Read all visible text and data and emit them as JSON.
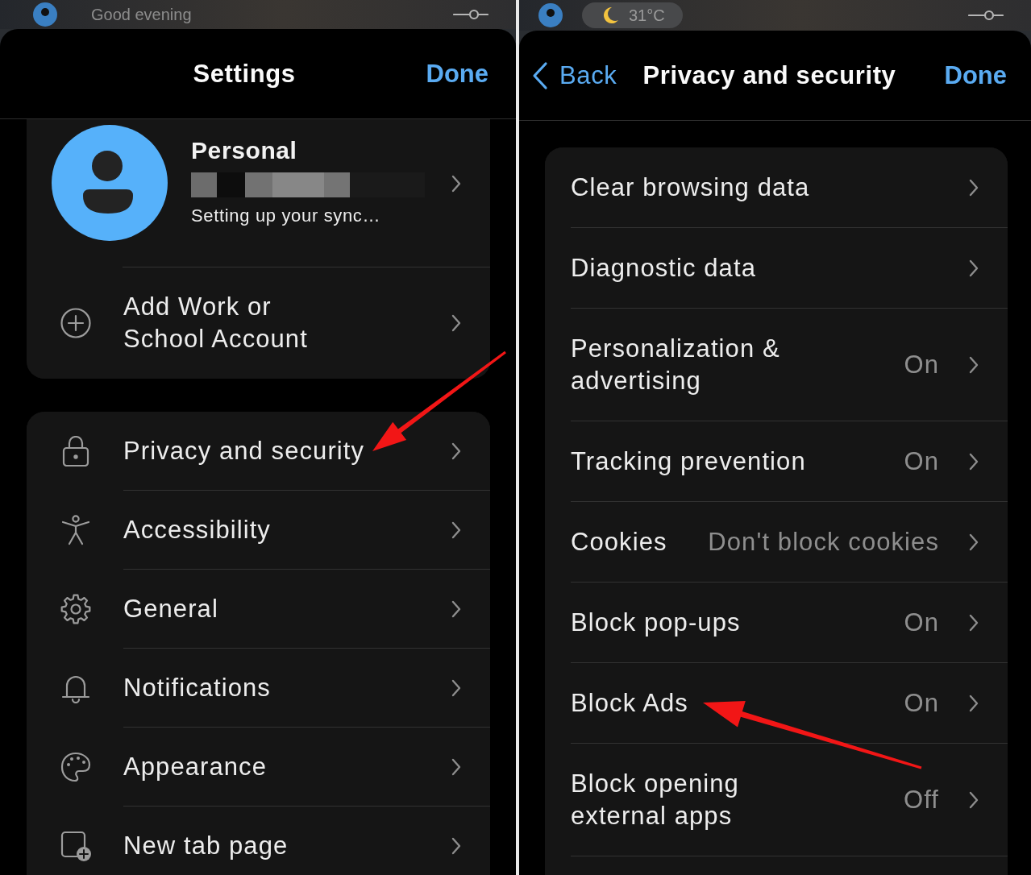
{
  "settings_sheet": {
    "background": {
      "greeting": "Good evening"
    },
    "title": "Settings",
    "done_button": "Done",
    "profile": {
      "name": "Personal",
      "status": "Setting up your sync…"
    },
    "add_account": "Add Work or School Account",
    "items": [
      {
        "label": "Privacy and security"
      },
      {
        "label": "Accessibility"
      },
      {
        "label": "General"
      },
      {
        "label": "Notifications"
      },
      {
        "label": "Appearance"
      },
      {
        "label": "New tab page"
      }
    ]
  },
  "privacy_sheet": {
    "background": {
      "temperature": "31°C"
    },
    "back_button": "Back",
    "title": "Privacy and security",
    "done_button": "Done",
    "items": [
      {
        "label": "Clear browsing data"
      },
      {
        "label": "Diagnostic data"
      },
      {
        "label": "Personalization & advertising",
        "value": "On"
      },
      {
        "label": "Tracking prevention",
        "value": "On"
      },
      {
        "label": "Cookies",
        "value": "Don't block cookies"
      },
      {
        "label": "Block pop-ups",
        "value": "On"
      },
      {
        "label": "Block Ads",
        "value": "On"
      },
      {
        "label": "Block opening external apps",
        "value": "Off"
      }
    ]
  }
}
